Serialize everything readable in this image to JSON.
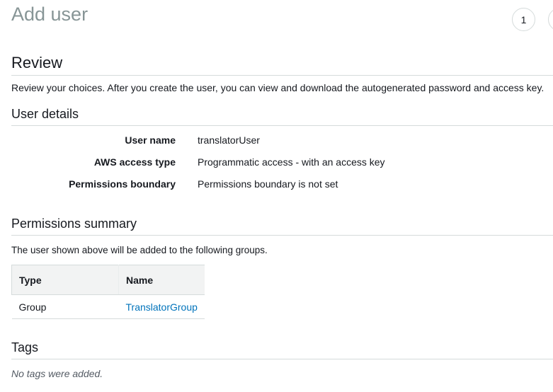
{
  "page": {
    "title": "Add user"
  },
  "steps": [
    {
      "number": "1"
    },
    {
      "number": ""
    }
  ],
  "review": {
    "title": "Review",
    "description": "Review your choices. After you create the user, you can view and download the autogenerated password and access key."
  },
  "user_details": {
    "title": "User details",
    "rows": [
      {
        "label": "User name",
        "value": "translatorUser"
      },
      {
        "label": "AWS access type",
        "value": "Programmatic access - with an access key"
      },
      {
        "label": "Permissions boundary",
        "value": "Permissions boundary is not set"
      }
    ]
  },
  "permissions_summary": {
    "title": "Permissions summary",
    "description": "The user shown above will be added to the following groups.",
    "columns": [
      "Type",
      "Name"
    ],
    "rows": [
      {
        "type": "Group",
        "name": "TranslatorGroup"
      }
    ]
  },
  "tags": {
    "title": "Tags",
    "empty_text": "No tags were added."
  },
  "colors": {
    "link": "#0073bb",
    "title_muted": "#879596",
    "table_header_bg": "#f2f3f3",
    "border": "#d5dbdb"
  }
}
